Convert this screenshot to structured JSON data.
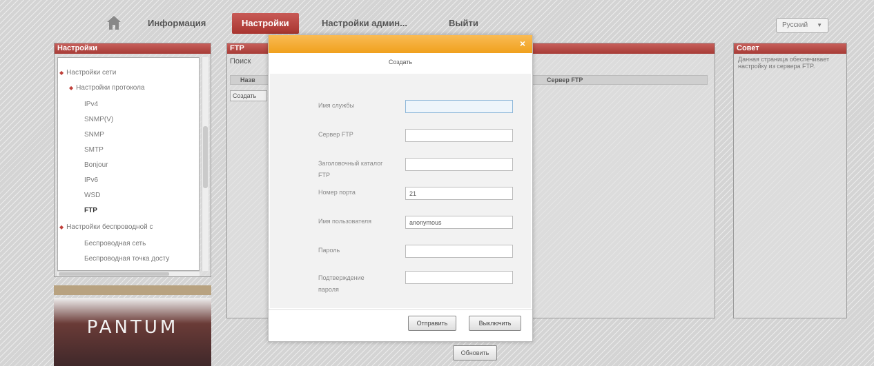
{
  "nav": {
    "home_icon": "home-icon",
    "items": [
      "Информация",
      "Настройки",
      "Настройки админ...",
      "Выйти"
    ],
    "active_index": 1,
    "language": "Русский"
  },
  "left_panel": {
    "title": "Настройки",
    "tree": [
      {
        "label": "Настройки сети",
        "level": 0,
        "bullet": true
      },
      {
        "label": "Настройки протокола",
        "level": 1,
        "bullet": true
      },
      {
        "label": "IPv4",
        "level": 2
      },
      {
        "label": "SNMP(V)",
        "level": 2
      },
      {
        "label": "SNMP",
        "level": 2
      },
      {
        "label": "SMTP",
        "level": 2
      },
      {
        "label": "Bonjour",
        "level": 2
      },
      {
        "label": "IPv6",
        "level": 2
      },
      {
        "label": "WSD",
        "level": 2
      },
      {
        "label": "FTP",
        "level": 2,
        "selected": true
      },
      {
        "label": "Настройки беспроводной с",
        "level": 1,
        "bullet": true
      },
      {
        "label": "Беспроводная сеть",
        "level": 2
      },
      {
        "label": "Беспроводная точка досту",
        "level": 2
      }
    ]
  },
  "logo_text": "PANTUM",
  "center_panel": {
    "title": "FTP",
    "subtitle": "Поиск",
    "columns": [
      "Назв",
      "Сервер FTP"
    ],
    "create_button": "Создать"
  },
  "right_panel": {
    "title": "Совет",
    "text": "Данная страница обеспечивает настройку из сервера FTP."
  },
  "refresh_button": "Обновить",
  "modal": {
    "title": "Создать",
    "close_glyph": "×",
    "fields": [
      {
        "label": "Имя службы",
        "value": "",
        "placeholder": ""
      },
      {
        "label": "Сервер FTP",
        "value": "",
        "placeholder": ""
      },
      {
        "label": "Заголовочный каталог FTP",
        "value": "",
        "placeholder": ""
      },
      {
        "label": "Номер порта",
        "value": "21",
        "placeholder": ""
      },
      {
        "label": "Имя пользователя",
        "value": "anonymous",
        "placeholder": ""
      },
      {
        "label": "Пароль",
        "value": "",
        "placeholder": ""
      },
      {
        "label": "Подтверждение пароля",
        "value": "",
        "placeholder": ""
      }
    ],
    "submit_button": "Отправить",
    "cancel_button": "Выключить"
  },
  "colors": {
    "accent_red": "#b4433e",
    "modal_bar": "#f2a525",
    "focus_border": "#8eb7d9"
  }
}
